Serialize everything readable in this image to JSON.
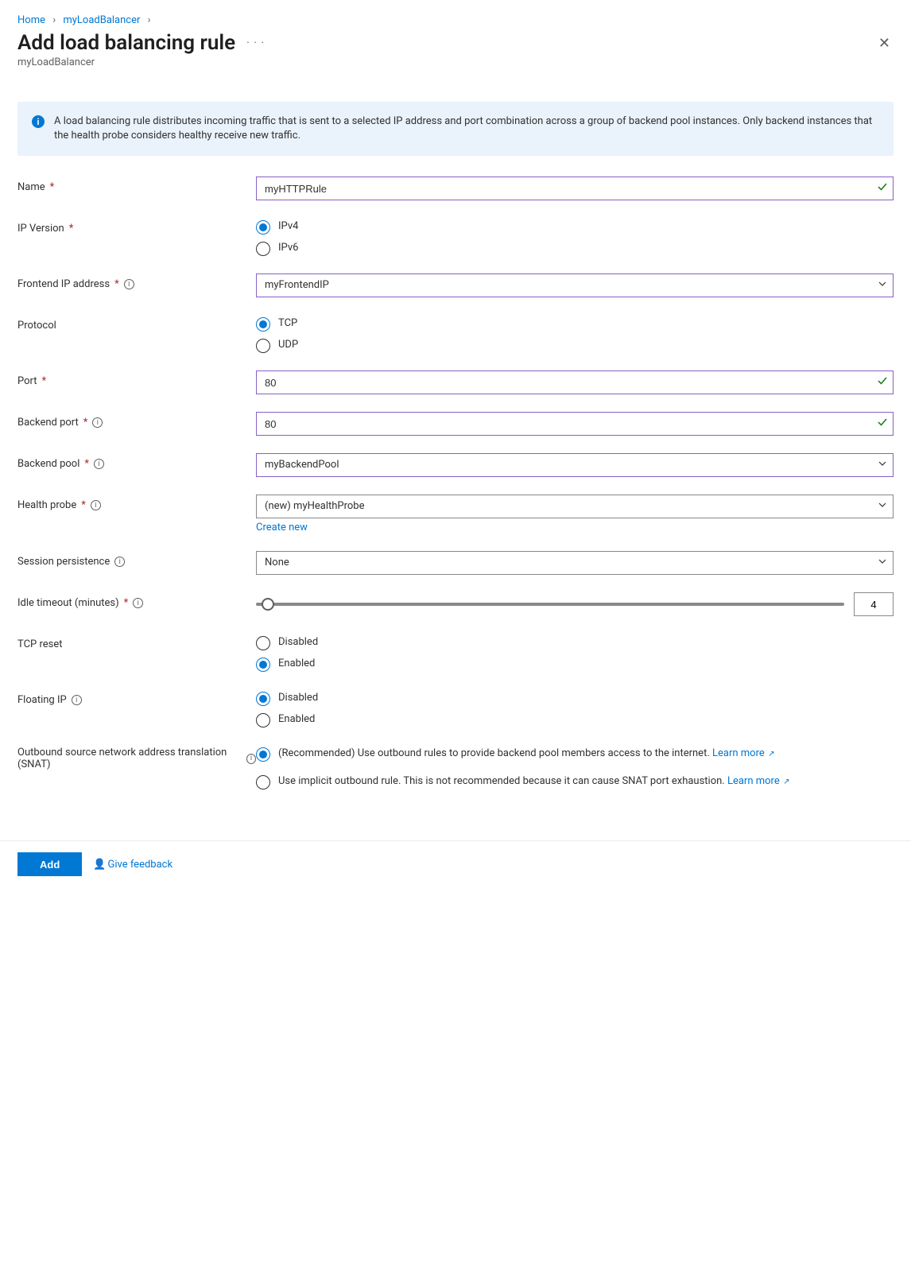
{
  "breadcrumb": {
    "home": "Home",
    "resource": "myLoadBalancer"
  },
  "title": "Add load balancing rule",
  "subtitle": "myLoadBalancer",
  "infoBox": "A load balancing rule distributes incoming traffic that is sent to a selected IP address and port combination across a group of backend pool instances. Only backend instances that the health probe considers healthy receive new traffic.",
  "labels": {
    "name": "Name",
    "ipVersion": "IP Version",
    "frontendIp": "Frontend IP address",
    "protocol": "Protocol",
    "port": "Port",
    "backendPort": "Backend port",
    "backendPool": "Backend pool",
    "healthProbe": "Health probe",
    "sessionPersistence": "Session persistence",
    "idleTimeout": "Idle timeout (minutes)",
    "tcpReset": "TCP reset",
    "floatingIp": "Floating IP",
    "snat": "Outbound source network address translation (SNAT)"
  },
  "values": {
    "name": "myHTTPRule",
    "ipVersion": {
      "ipv4": "IPv4",
      "ipv6": "IPv6"
    },
    "frontendIp": "myFrontendIP",
    "protocol": {
      "tcp": "TCP",
      "udp": "UDP"
    },
    "port": "80",
    "backendPort": "80",
    "backendPool": "myBackendPool",
    "healthProbe": "(new) myHealthProbe",
    "createNew": "Create new",
    "sessionPersistence": "None",
    "idleTimeout": "4",
    "tcpReset": {
      "disabled": "Disabled",
      "enabled": "Enabled"
    },
    "floatingIp": {
      "disabled": "Disabled",
      "enabled": "Enabled"
    },
    "snat": {
      "recommendedPrefix": "(Recommended) Use outbound rules to provide backend pool members access to the internet. ",
      "implicitPrefix": "Use implicit outbound rule. This is not recommended because it can cause SNAT port exhaustion. ",
      "learnMore": "Learn more"
    }
  },
  "footer": {
    "add": "Add",
    "feedback": "Give feedback"
  }
}
